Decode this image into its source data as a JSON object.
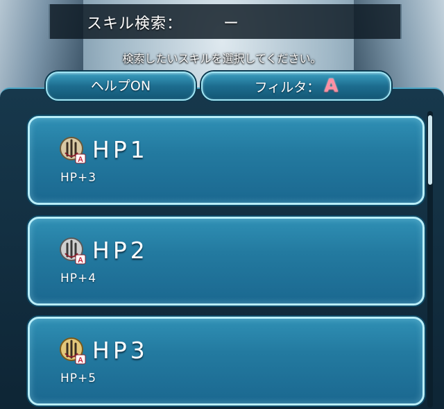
{
  "header": {
    "search_label": "スキル検索：",
    "search_value": "ー",
    "instruction": "検索したいスキルを選択してください。"
  },
  "buttons": {
    "help_label": "ヘルプON",
    "filter_label": "フィルタ：",
    "filter_value": "A"
  },
  "skills": [
    {
      "name": "HP1",
      "description": "HP+3",
      "icon": "hp-skill-icon",
      "slot": "A"
    },
    {
      "name": "HP2",
      "description": "HP+4",
      "icon": "hp-skill-icon",
      "slot": "A"
    },
    {
      "name": "HP3",
      "description": "HP+5",
      "icon": "hp-skill-icon",
      "slot": "A"
    }
  ],
  "colors": {
    "accent": "#9fe6f5",
    "card_fill": "#237aa0",
    "filter_grade": "#ff8fa3"
  }
}
